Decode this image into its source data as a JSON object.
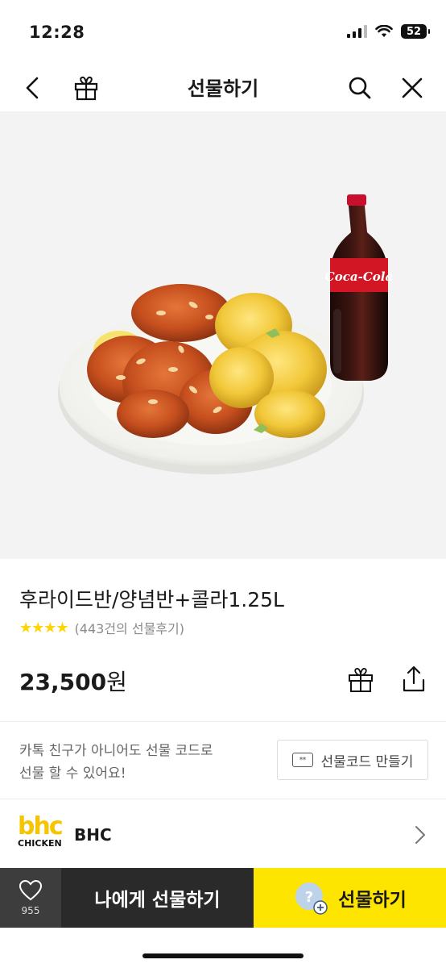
{
  "status_bar": {
    "time": "12:28",
    "battery": "52"
  },
  "nav": {
    "title": "선물하기",
    "back_icon": "chevron-left-icon",
    "gift_icon": "gift-icon",
    "search_icon": "search-icon",
    "close_icon": "close-icon"
  },
  "product": {
    "title": "후라이드반/양념반+콜라1.25L",
    "stars": "★★★★",
    "rating": 4,
    "review_count": "(443건의 선물후기)",
    "price": "23,500",
    "price_unit": "원",
    "image_label": "Coca-Cola"
  },
  "gift_code": {
    "info_line1": "카톡 친구가 아니어도 선물 코드로",
    "info_line2": "선물 할 수 있어요!",
    "button_label": "선물코드 만들기",
    "icon_text": "**"
  },
  "brand": {
    "logo_text_top": "bhc",
    "logo_text_bottom": "CHICKEN",
    "name": "BHC"
  },
  "bottom_bar": {
    "wish_count": "955",
    "self_gift_label": "나에게 선물하기",
    "gift_label": "선물하기",
    "gift_emoji_text": "?"
  },
  "colors": {
    "accent_yellow": "#fee500",
    "star_yellow": "#ffd400",
    "dark_button": "#2a2a2a",
    "brand_yellow": "#f6c400"
  }
}
